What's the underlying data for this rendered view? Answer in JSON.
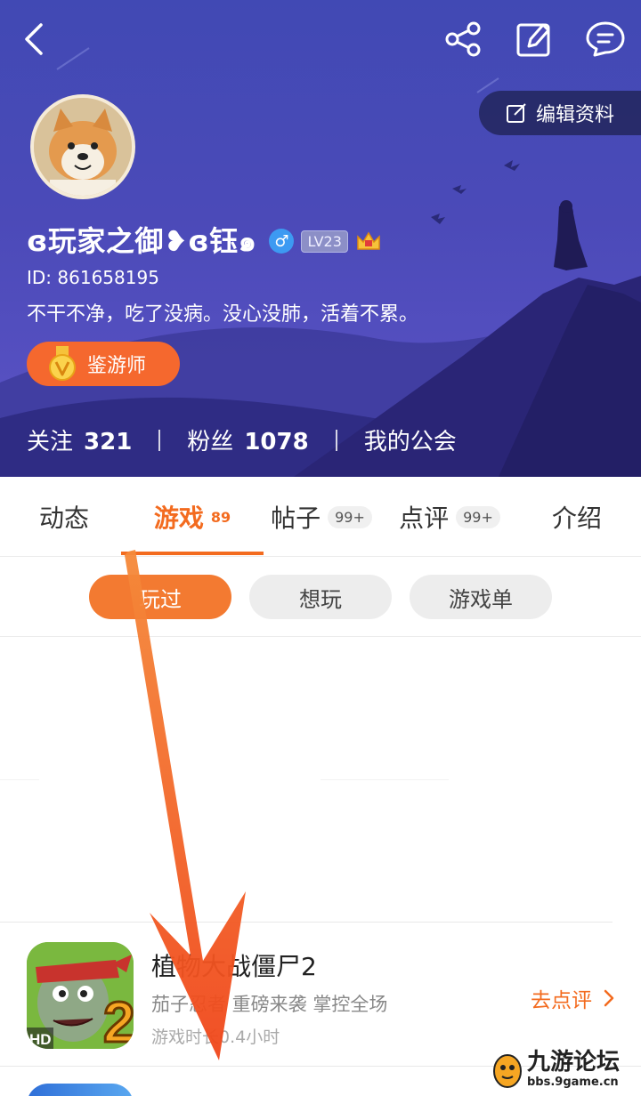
{
  "header": {
    "edit_profile_label": "编辑资料",
    "username": "ɞ玩家之御❥ɞ钰๑",
    "gender_symbol": "♂",
    "level": "LV23",
    "user_id": "ID: 861658195",
    "bio": "不干不净，吃了没病。没心没肺，活着不累。",
    "badge_label": "鉴游师",
    "stats": {
      "following_label": "关注",
      "following_count": "321",
      "fans_label": "粉丝",
      "fans_count": "1078",
      "guild_label": "我的公会"
    },
    "colors": {
      "background": "#4b4ab8",
      "badge": "#f5682e"
    }
  },
  "tabs": [
    {
      "label": "动态"
    },
    {
      "label": "游戏",
      "count": "89",
      "active": true
    },
    {
      "label": "帖子",
      "count": "99+"
    },
    {
      "label": "点评",
      "count": "99+"
    },
    {
      "label": "介绍"
    }
  ],
  "filters": [
    {
      "label": "玩过",
      "active": true
    },
    {
      "label": "想玩"
    },
    {
      "label": "游戏单"
    }
  ],
  "games": [
    {
      "title": "植物大战僵尸2",
      "tags": "茄子忍者 重磅来袭 掌控全场",
      "playtime": "游戏时长0.4小时",
      "action_label": "去点评",
      "icon_badge": "HD",
      "icon_number": "2"
    }
  ],
  "watermark": {
    "name": "九游论坛",
    "url": "bbs.9game.cn"
  },
  "accent_color": "#f36b1f",
  "icons": [
    "back-icon",
    "share-icon",
    "edit-icon",
    "message-icon",
    "edit-profile-icon",
    "crown-icon",
    "medal-icon",
    "chevron-right-icon"
  ]
}
